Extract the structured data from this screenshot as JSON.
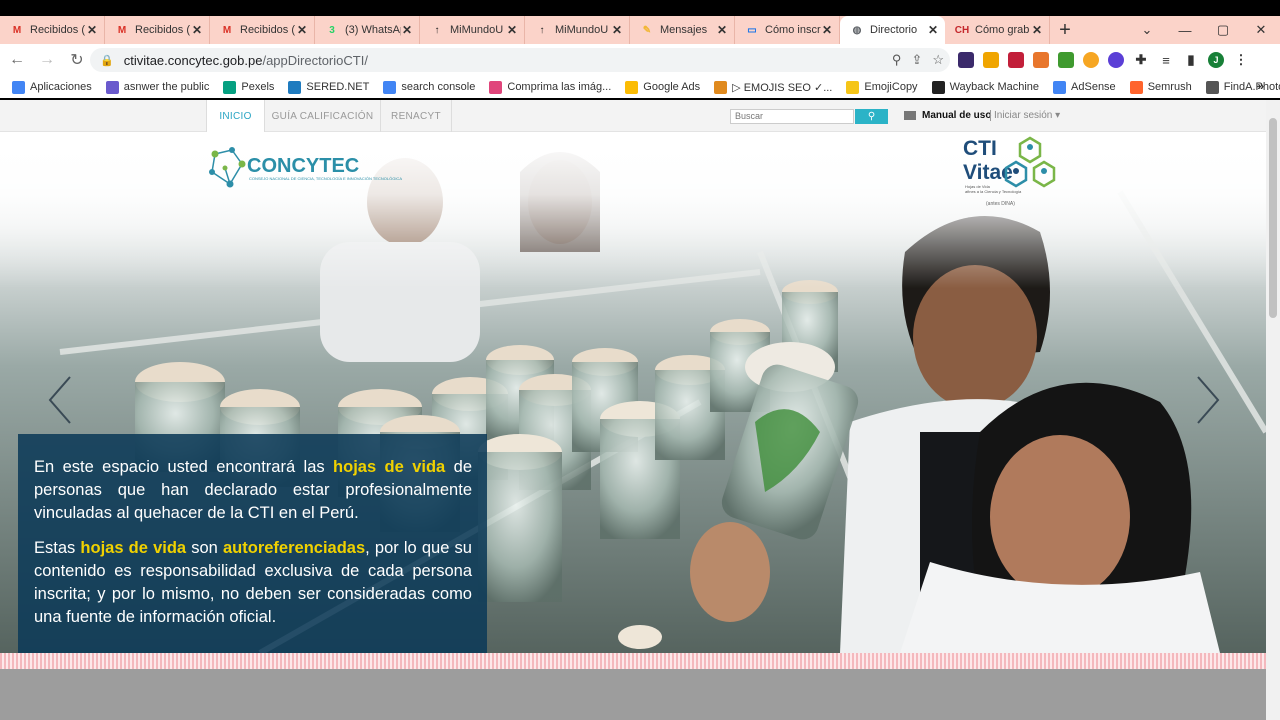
{
  "browser": {
    "tabs": [
      {
        "title": "Recibidos (",
        "icon": "gmail-icon",
        "color": "#d93025",
        "glyph": "M"
      },
      {
        "title": "Recibidos (",
        "icon": "gmail-icon",
        "color": "#d93025",
        "glyph": "M"
      },
      {
        "title": "Recibidos (",
        "icon": "gmail-icon",
        "color": "#d93025",
        "glyph": "M"
      },
      {
        "title": "(3) WhatsAp",
        "icon": "whatsapp-icon",
        "color": "#25d366",
        "glyph": "3"
      },
      {
        "title": "MiMundoU",
        "icon": "pin-icon",
        "color": "#222222",
        "glyph": "↑"
      },
      {
        "title": "MiMundoU",
        "icon": "pin-icon",
        "color": "#222222",
        "glyph": "↑"
      },
      {
        "title": "Mensajes",
        "icon": "messages-icon",
        "color": "#f2b632",
        "glyph": "✎"
      },
      {
        "title": "Cómo inscr",
        "icon": "doc-icon",
        "color": "#1a73e8",
        "glyph": "▭"
      },
      {
        "title": "Directorio",
        "icon": "globe-icon",
        "color": "#5f6368",
        "glyph": "◍",
        "active": true
      },
      {
        "title": "Cómo grab",
        "icon": "ch-icon",
        "color": "#c4272c",
        "glyph": "CH"
      }
    ],
    "new_tab": "+",
    "url_host": "ctivitae.concytec.gob.pe",
    "url_path": "/appDirectorioCTI/",
    "bookmarks": [
      {
        "label": "Aplicaciones",
        "icon": "apps-icon",
        "color": "#4285f4"
      },
      {
        "label": "asnwer the public",
        "icon": "atp-icon",
        "color": "#6a5acd"
      },
      {
        "label": "Pexels",
        "icon": "pexels-icon",
        "color": "#05a081"
      },
      {
        "label": "SERED.NET",
        "icon": "sered-icon",
        "color": "#1f7bbf"
      },
      {
        "label": "search console",
        "icon": "searchconsole-icon",
        "color": "#4285f4"
      },
      {
        "label": "Comprima las imág...",
        "icon": "compress-icon",
        "color": "#e0457b"
      },
      {
        "label": "Google Ads",
        "icon": "googleads-icon",
        "color": "#fbbc04"
      },
      {
        "label": "▷ EMOJIS SEO ✓...",
        "icon": "emojis-icon",
        "color": "#e08a1e"
      },
      {
        "label": "EmojiCopy",
        "icon": "emojicopy-icon",
        "color": "#f5c518"
      },
      {
        "label": "Wayback Machine",
        "icon": "wayback-icon",
        "color": "#222222"
      },
      {
        "label": "AdSense",
        "icon": "adsense-icon",
        "color": "#4285f4"
      },
      {
        "label": "Semrush",
        "icon": "semrush-icon",
        "color": "#ff642d"
      },
      {
        "label": "FindA.Photo",
        "icon": "findaphoto-icon",
        "color": "#555555"
      }
    ],
    "bookmarks_more": "»",
    "profile_initial": "J"
  },
  "site": {
    "nav": [
      "INICIO",
      "GUÍA CALIFICACIÓN",
      "RENACYT"
    ],
    "search_placeholder": "Buscar",
    "manual_label": "Manual de uso",
    "login_label": "Iniciar sesión ▾",
    "logo_concytec": "CONCYTEC",
    "logo_concytec_sub": "CONSEJO NACIONAL DE CIENCIA, TECNOLOGÍA E INNOVACIÓN TECNOLÓGICA",
    "logo_cti": "CTI",
    "logo_vitae": "Vitae",
    "logo_cti_sub1": "Hojas de Vida",
    "logo_cti_sub2": "afines a la Ciencia y Tecnología",
    "logo_cti_sub3": "(antes DINA)",
    "caption": {
      "p1_a": "En este espacio usted encontrará las ",
      "p1_hl": "hojas de vida",
      "p1_b": " de personas que han declarado estar profesionalmente vinculadas al quehacer de la CTI en el Perú.",
      "p2_a": "Estas ",
      "p2_hl1": "hojas de vida",
      "p2_b": " son ",
      "p2_hl2": "autoreferenciadas",
      "p2_c": ", por lo que su contenido es responsabilidad exclusiva de cada persona inscrita; y por lo mismo, no deben ser consideradas como una fuente de información oficial."
    }
  }
}
